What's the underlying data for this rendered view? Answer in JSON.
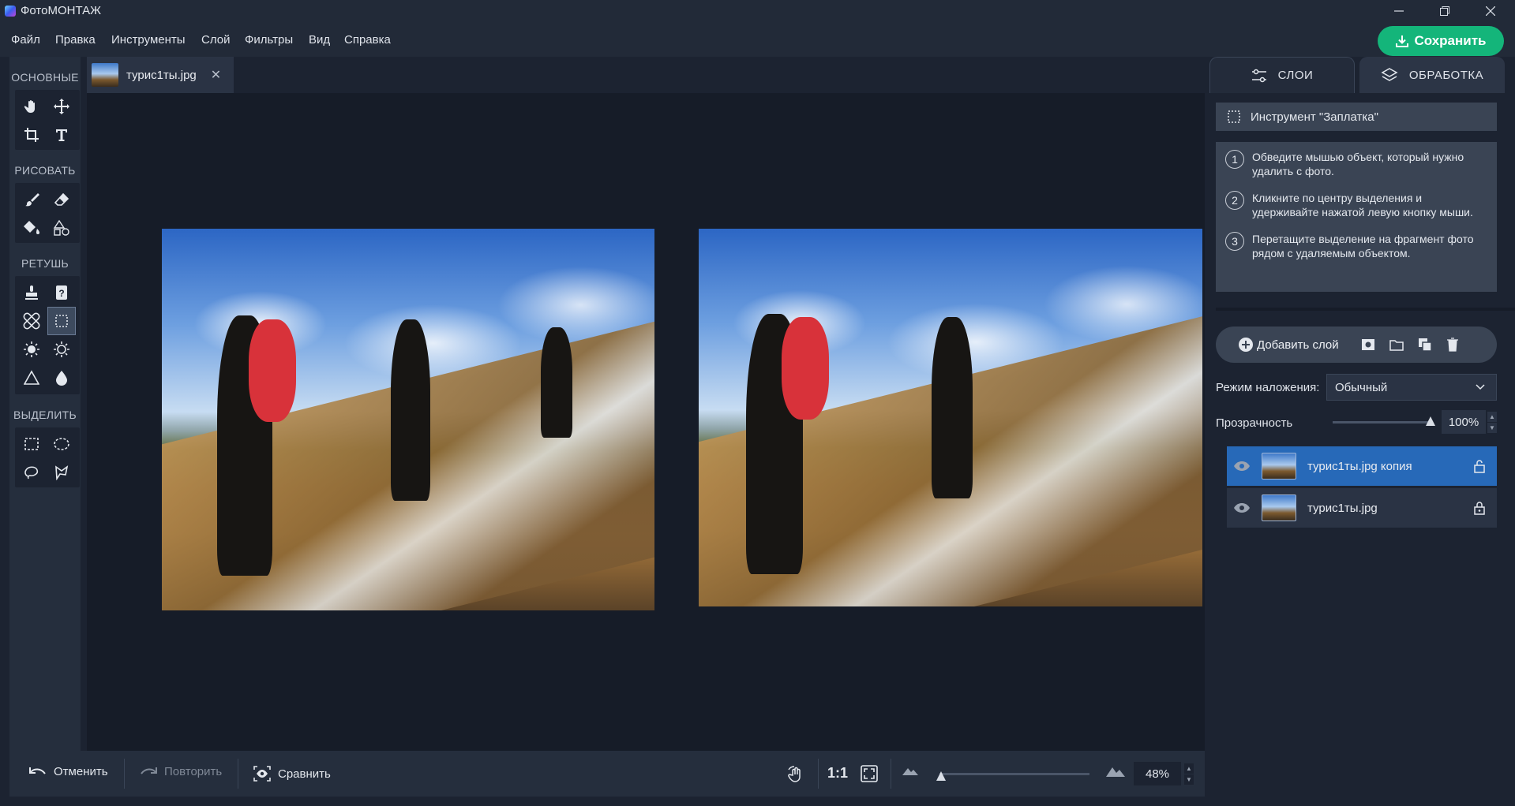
{
  "app": {
    "title": "ФотоМОНТАЖ"
  },
  "menu": [
    "Файл",
    "Правка",
    "Инструменты",
    "Слой",
    "Фильтры",
    "Вид",
    "Справка"
  ],
  "save_label": "Сохранить",
  "toolbox": {
    "sections": [
      "ОСНОВНЫЕ",
      "РИСОВАТЬ",
      "РЕТУШЬ",
      "ВЫДЕЛИТЬ"
    ],
    "active_tool": "patch-tool"
  },
  "document": {
    "tab_title": "турис1ты.jpg",
    "close_glyph": "✕"
  },
  "panel": {
    "tabs": [
      "СЛОИ",
      "ОБРАБОТКА"
    ],
    "tool_name": "Инструмент \"Заплатка\"",
    "steps": [
      {
        "num": "1",
        "text": "Обведите мышью объект, который нужно удалить с фото."
      },
      {
        "num": "2",
        "text": "Кликните по центру выделения и удерживайте нажатой левую кнопку мыши."
      },
      {
        "num": "3",
        "text": "Перетащите выделение на фрагмент фото рядом с удаляемым объектом."
      }
    ],
    "add_layer_label": "Добавить слой",
    "blend_label": "Режим наложения:",
    "blend_value": "Обычный",
    "opacity_label": "Прозрачность",
    "opacity_value": "100%",
    "layers": [
      {
        "name": "турис1ты.jpg копия",
        "selected": true,
        "locked": false
      },
      {
        "name": "турис1ты.jpg",
        "selected": false,
        "locked": true
      }
    ]
  },
  "bottom": {
    "undo_label": "Отменить",
    "redo_label": "Повторить",
    "compare_label": "Сравнить",
    "actual_size_label": "1:1",
    "zoom_value": "48%",
    "zoom_fraction": 0.0
  },
  "colors": {
    "accent": "#14b57a",
    "selected_layer": "#2769b8",
    "panel_bg": "#1c2331"
  }
}
